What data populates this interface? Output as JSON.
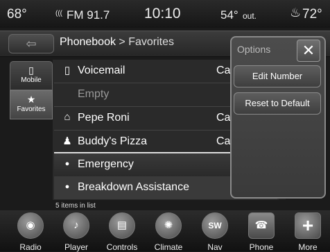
{
  "status": {
    "temp_in": "68°",
    "radio_icon": "(((",
    "radio": "FM 91.7",
    "time": "10:10",
    "temp_out": "54°",
    "temp_out_suffix": "out.",
    "seat_heat_icon": "seat-heat-icon",
    "temp_right": "72°"
  },
  "breadcrumb": {
    "back_arrow": "⇦",
    "title": "Phonebook",
    "separator": " > ",
    "sub": "Favorites"
  },
  "side_tabs": [
    {
      "label": "Mobile",
      "icon": "▯"
    },
    {
      "label": "Favorites",
      "icon": "★"
    }
  ],
  "list": {
    "rows": [
      {
        "label": "Voicemail",
        "icon": "▯",
        "extra": "Ca"
      },
      {
        "label": "Empty",
        "icon": "",
        "extra": ""
      },
      {
        "label": "Pepe Roni",
        "icon": "⌂",
        "extra": "Ca"
      },
      {
        "label": "Buddy's Pizza",
        "icon": "♟",
        "extra": "Ca"
      },
      {
        "label": "Emergency",
        "icon": "●",
        "extra": ""
      },
      {
        "label": "Breakdown Assistance",
        "icon": "●",
        "extra": ""
      }
    ],
    "count": "5 items in list"
  },
  "options": {
    "title": "Options",
    "close": "✕",
    "buttons": [
      "Edit Number",
      "Reset to Default"
    ]
  },
  "nav": [
    {
      "label": "Radio",
      "icon": "◉"
    },
    {
      "label": "Player",
      "icon": "♪"
    },
    {
      "label": "Controls",
      "icon": "▤"
    },
    {
      "label": "Climate",
      "icon": "✺"
    },
    {
      "label": "Nav",
      "icon": "SW"
    },
    {
      "label": "Phone",
      "icon": "☎"
    },
    {
      "label": "More",
      "icon": "+"
    }
  ]
}
